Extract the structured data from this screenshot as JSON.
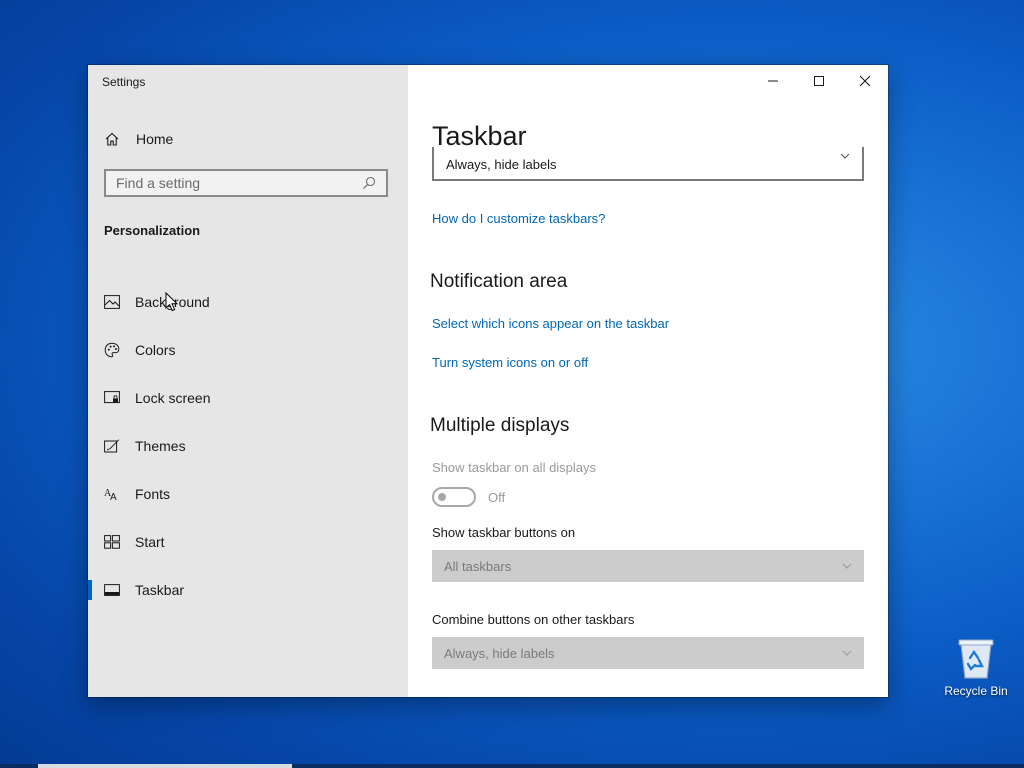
{
  "desktop": {
    "recycle_bin_label": "Recycle Bin"
  },
  "window": {
    "app_title": "Settings",
    "sidebar": {
      "home_label": "Home",
      "search_placeholder": "Find a setting",
      "section_heading": "Personalization",
      "items": [
        {
          "label": "Background",
          "icon": "picture-icon"
        },
        {
          "label": "Colors",
          "icon": "palette-icon"
        },
        {
          "label": "Lock screen",
          "icon": "lock-screen-icon"
        },
        {
          "label": "Themes",
          "icon": "themes-icon"
        },
        {
          "label": "Fonts",
          "icon": "fonts-icon"
        },
        {
          "label": "Start",
          "icon": "start-icon"
        },
        {
          "label": "Taskbar",
          "icon": "taskbar-icon",
          "active": true
        }
      ]
    },
    "content": {
      "page_title": "Taskbar",
      "combine_top_value": "Always, hide labels",
      "customize_link": "How do I customize taskbars?",
      "notification_area": {
        "heading": "Notification area",
        "link_icons": "Select which icons appear on the taskbar",
        "link_system_icons": "Turn system icons on or off"
      },
      "multiple_displays": {
        "heading": "Multiple displays",
        "show_all_label": "Show taskbar on all displays",
        "toggle_state": "Off",
        "buttons_on_label": "Show taskbar buttons on",
        "buttons_on_value": "All taskbars",
        "combine_other_label": "Combine buttons on other taskbars",
        "combine_other_value": "Always, hide labels"
      }
    }
  },
  "colors": {
    "accent": "#0067c0",
    "link": "#0067b8",
    "sidebar_bg": "#e6e6e6",
    "disabled_combo": "#cccccc"
  }
}
